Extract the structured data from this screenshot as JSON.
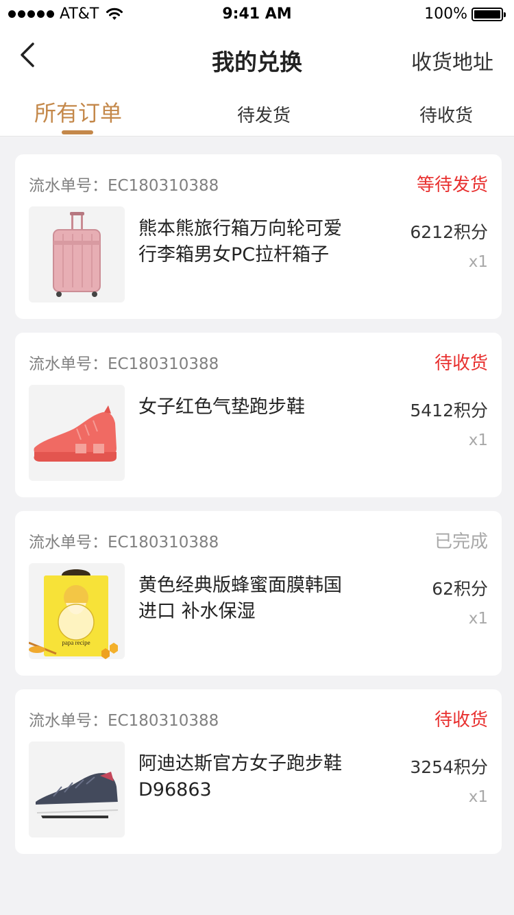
{
  "status_bar": {
    "carrier": "AT&T",
    "time": "9:41 AM",
    "battery": "100%"
  },
  "nav": {
    "title": "我的兑换",
    "right_action": "收货地址"
  },
  "tabs": [
    {
      "label": "所有订单",
      "active": true
    },
    {
      "label": "待发货",
      "active": false
    },
    {
      "label": "待收货",
      "active": false
    }
  ],
  "orders": [
    {
      "order_label": "流水单号：EC180310388",
      "status": "等待发货",
      "name": "熊本熊旅行箱万向轮可爱行李箱男女PC拉杆箱子",
      "points": "6212积分",
      "qty": "x1",
      "image": "pink-suitcase"
    },
    {
      "order_label": "流水单号：EC180310388",
      "status": "待收货",
      "name": "女子红色气垫跑步鞋",
      "points": "5412积分",
      "qty": "x1",
      "image": "coral-sneaker"
    },
    {
      "order_label": "流水单号：EC180310388",
      "status": "已完成",
      "name": "黄色经典版蜂蜜面膜韩国进口 补水保湿",
      "points": "62积分",
      "qty": "x1",
      "image": "honey-mask",
      "image_text": "papa recipe"
    },
    {
      "order_label": "流水单号：EC180310388",
      "status": "待收货",
      "name": "阿迪达斯官方女子跑步鞋D96863",
      "points": "3254积分",
      "qty": "x1",
      "image": "navy-sneaker"
    }
  ],
  "colors": {
    "accent": "#c4884a",
    "status_red": "#e8302f",
    "status_gray": "#a8a8a8",
    "background": "#f2f2f4"
  }
}
